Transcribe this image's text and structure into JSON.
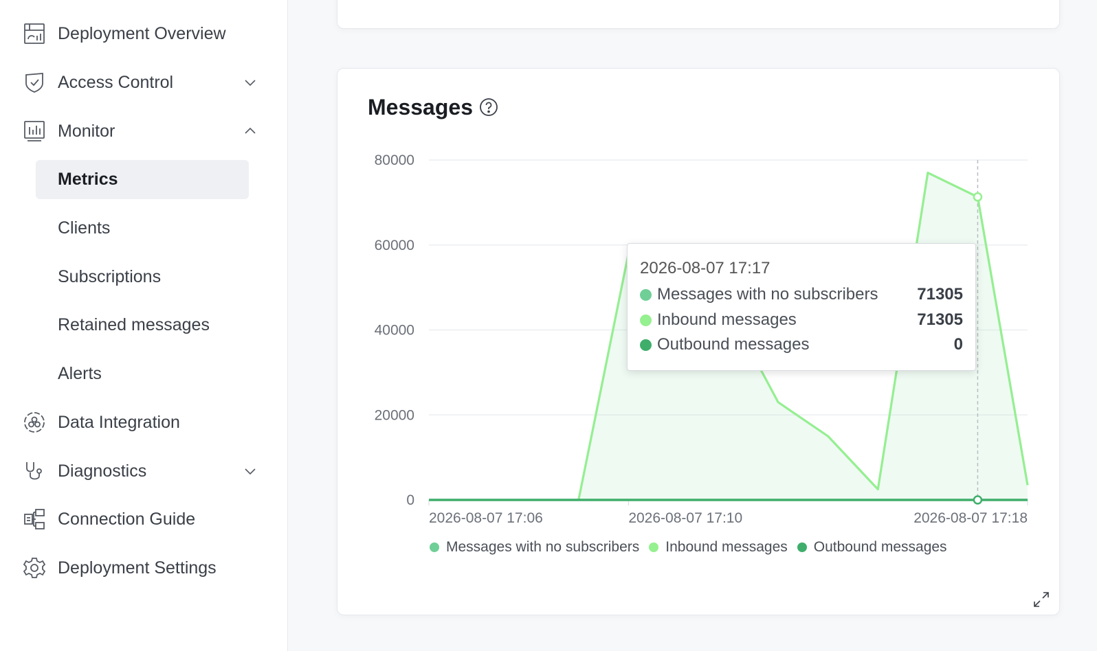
{
  "sidebar": {
    "items": [
      {
        "label": "Deployment Overview",
        "icon": "dashboard-icon"
      },
      {
        "label": "Access Control",
        "icon": "shield-icon",
        "expandable": true
      },
      {
        "label": "Monitor",
        "icon": "bar-chart-icon",
        "expandable": true,
        "expanded": true
      },
      {
        "label": "Data Integration",
        "icon": "integration-icon"
      },
      {
        "label": "Diagnostics",
        "icon": "stethoscope-icon",
        "expandable": true
      },
      {
        "label": "Connection Guide",
        "icon": "connection-icon"
      },
      {
        "label": "Deployment Settings",
        "icon": "gear-icon"
      }
    ],
    "monitor_children": [
      {
        "label": "Metrics",
        "active": true
      },
      {
        "label": "Clients"
      },
      {
        "label": "Subscriptions"
      },
      {
        "label": "Retained messages"
      },
      {
        "label": "Alerts"
      }
    ]
  },
  "messages_card": {
    "title": "Messages",
    "tooltip": {
      "title": "2026-08-07 17:17",
      "rows": [
        {
          "name": "Messages with no subscribers",
          "value": "71305"
        },
        {
          "name": "Inbound messages",
          "value": "71305"
        },
        {
          "name": "Outbound messages",
          "value": "0"
        }
      ]
    }
  },
  "chart_data": {
    "type": "area",
    "title": "Messages",
    "xlabel": "",
    "ylabel": "",
    "ylim": [
      0,
      80000
    ],
    "yticks": [
      0,
      20000,
      40000,
      60000,
      80000
    ],
    "xtick_labels": [
      "2026-08-07 17:06",
      "2026-08-07 17:10",
      "2026-08-07 17:18"
    ],
    "x": [
      "17:06",
      "17:07",
      "17:08",
      "17:09",
      "17:10",
      "17:11",
      "17:12",
      "17:13",
      "17:14",
      "17:15",
      "17:16",
      "17:17",
      "17:18"
    ],
    "series": [
      {
        "name": "Messages with no subscribers",
        "color": "#6fcf97",
        "values": [
          0,
          0,
          0,
          0,
          58000,
          60000,
          45000,
          23000,
          15000,
          2500,
          77000,
          71305,
          3500
        ]
      },
      {
        "name": "Inbound messages",
        "color": "#95f08f",
        "values": [
          0,
          0,
          0,
          0,
          58000,
          60000,
          45000,
          23000,
          15000,
          2500,
          77000,
          71305,
          3500
        ]
      },
      {
        "name": "Outbound messages",
        "color": "#3fae6b",
        "values": [
          0,
          0,
          0,
          0,
          0,
          0,
          0,
          0,
          0,
          0,
          0,
          0,
          0
        ]
      }
    ],
    "legend_position": "bottom",
    "grid": true,
    "hover_x": "17:17"
  },
  "colors": {
    "legend_no_sub": "#6fcf97",
    "legend_inbound": "#95f08f",
    "legend_outbound": "#3fae6b"
  }
}
